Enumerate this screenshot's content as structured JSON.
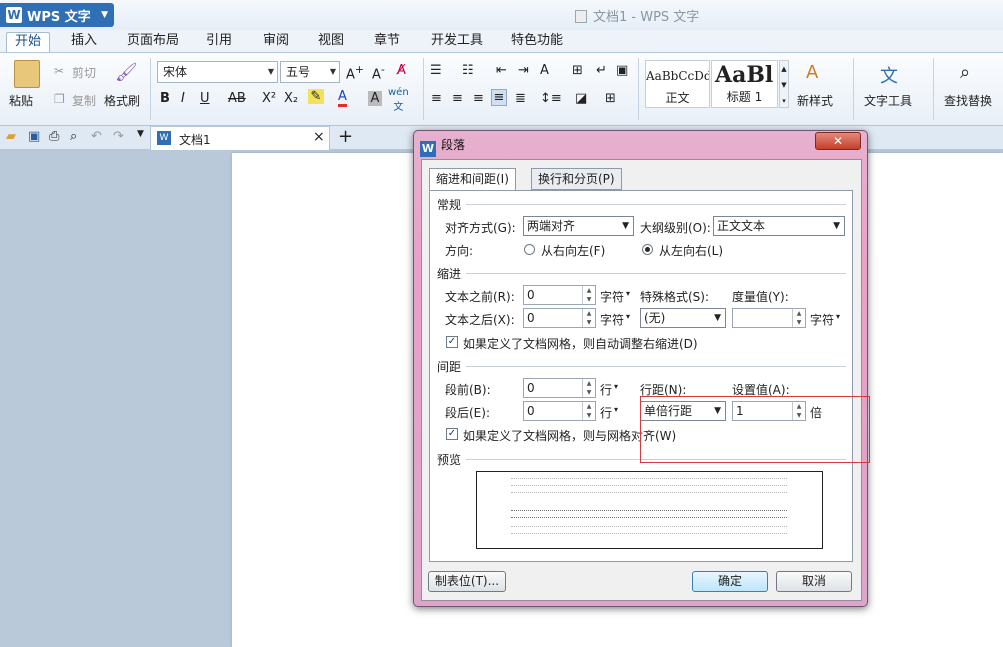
{
  "app": {
    "name": "WPS 文字",
    "doc_title": "文档1 - WPS 文字"
  },
  "menu": [
    "开始",
    "插入",
    "页面布局",
    "引用",
    "审阅",
    "视图",
    "章节",
    "开发工具",
    "特色功能"
  ],
  "ribbon": {
    "paste": "粘贴",
    "cut": "剪切",
    "copy": "复制",
    "format_painter": "格式刷",
    "font": "宋体",
    "size": "五号",
    "style_normal_sample": "AaBbCcDd",
    "style_normal": "正文",
    "style_h1_sample": "AaBl",
    "style_h1": "标题 1",
    "new_style": "新样式",
    "text_tools": "文字工具",
    "find_replace": "查找替换"
  },
  "quickbar": {
    "tab_label": "文档1"
  },
  "dialog": {
    "title": "段落",
    "tabs": [
      "缩进和间距(I)",
      "换行和分页(P)"
    ],
    "general": {
      "section": "常规",
      "align_label": "对齐方式(G):",
      "align_value": "两端对齐",
      "outline_label": "大纲级别(O):",
      "outline_value": "正文文本",
      "direction_label": "方向:",
      "rtl": "从右向左(F)",
      "ltr": "从左向右(L)"
    },
    "indent": {
      "section": "缩进",
      "before_label": "文本之前(R):",
      "before_value": "0",
      "before_unit": "字符",
      "after_label": "文本之后(X):",
      "after_value": "0",
      "after_unit": "字符",
      "special_label": "特殊格式(S):",
      "special_value": "(无)",
      "measure_label": "度量值(Y):",
      "measure_value": "",
      "measure_unit": "字符",
      "grid_check": "如果定义了文档网格，则自动调整右缩进(D)"
    },
    "spacing": {
      "section": "间距",
      "before_label": "段前(B):",
      "before_value": "0",
      "before_unit": "行",
      "after_label": "段后(E):",
      "after_value": "0",
      "after_unit": "行",
      "line_label": "行距(N):",
      "line_value": "单倍行距",
      "set_label": "设置值(A):",
      "set_value": "1",
      "set_unit": "倍",
      "grid_check": "如果定义了文档网格，则与网格对齐(W)"
    },
    "preview_label": "预览",
    "tabs_button": "制表位(T)...",
    "ok": "确定",
    "cancel": "取消"
  }
}
